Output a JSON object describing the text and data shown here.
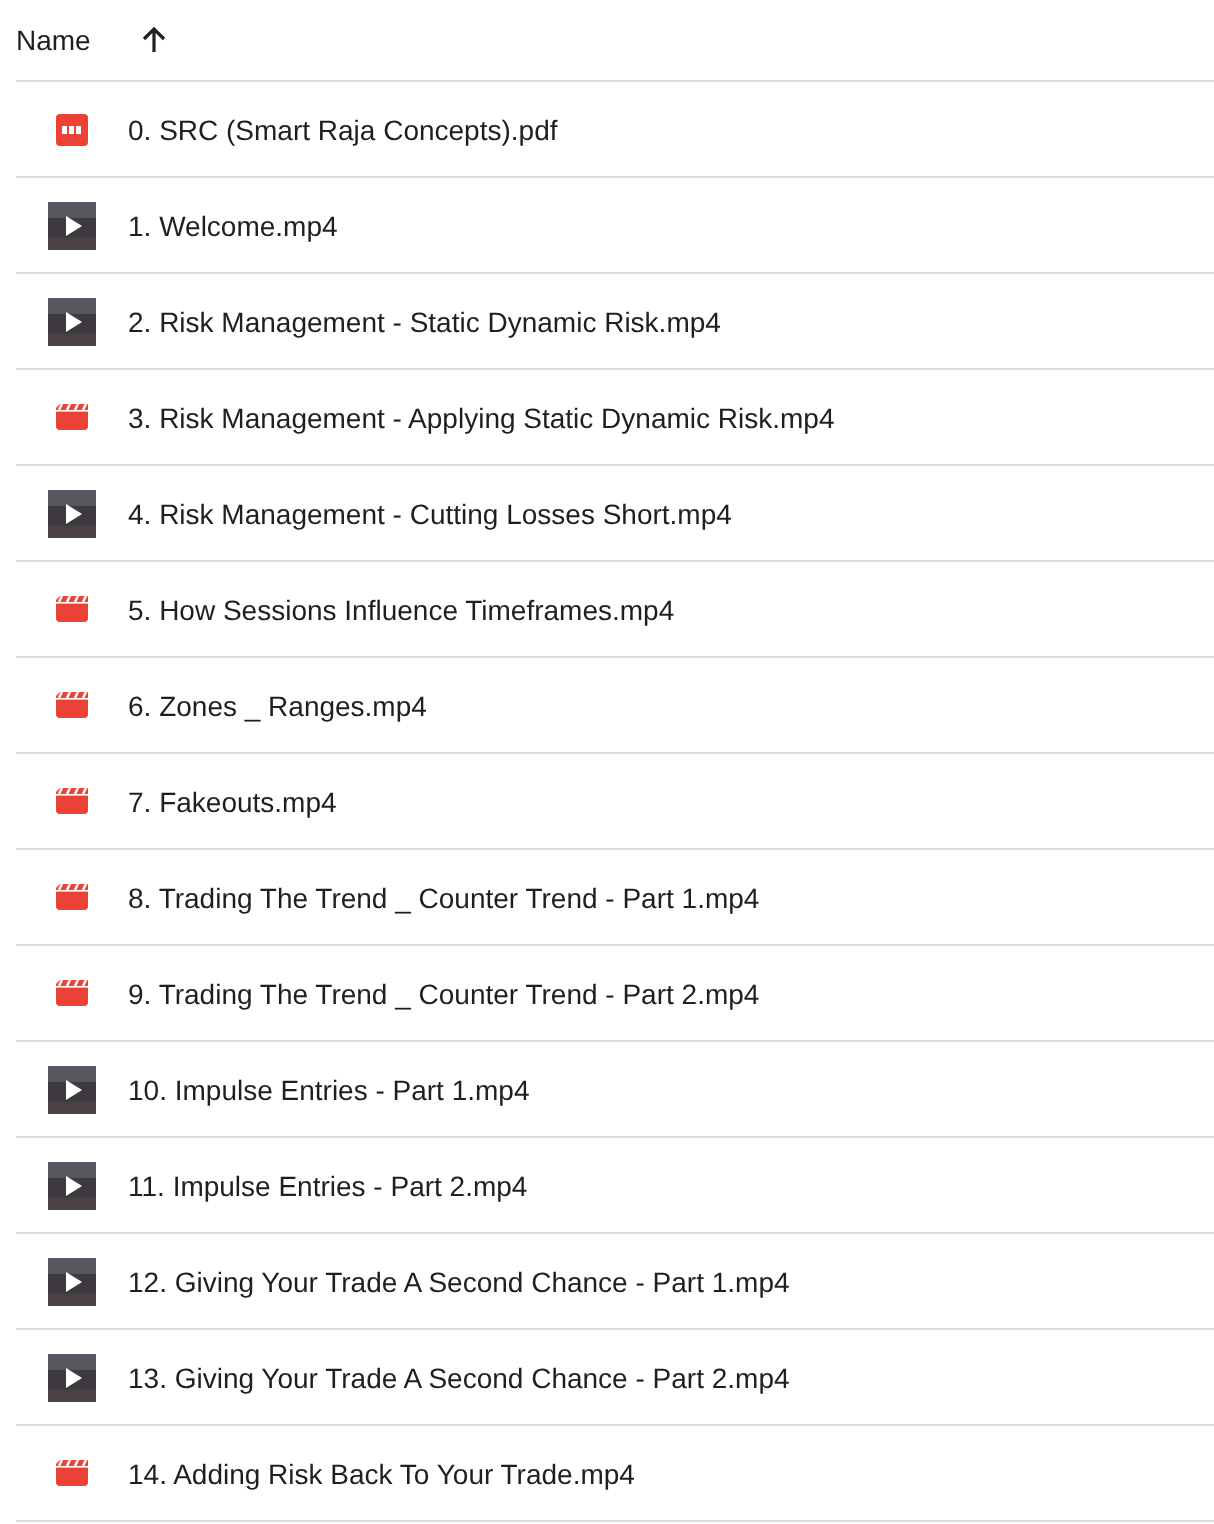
{
  "header": {
    "column": "Name",
    "sort_ascending": true
  },
  "files": [
    {
      "name": "0. SRC (Smart Raja Concepts).pdf",
      "kind": "pdf"
    },
    {
      "name": "1. Welcome.mp4",
      "kind": "thumbnail"
    },
    {
      "name": "2. Risk Management - Static Dynamic Risk.mp4",
      "kind": "thumbnail"
    },
    {
      "name": "3. Risk Management - Applying Static Dynamic Risk.mp4",
      "kind": "video"
    },
    {
      "name": "4. Risk Management - Cutting Losses Short.mp4",
      "kind": "thumbnail"
    },
    {
      "name": "5. How Sessions Influence Timeframes.mp4",
      "kind": "video"
    },
    {
      "name": "6. Zones _ Ranges.mp4",
      "kind": "video"
    },
    {
      "name": "7. Fakeouts.mp4",
      "kind": "video"
    },
    {
      "name": "8. Trading The Trend _ Counter Trend - Part 1.mp4",
      "kind": "video"
    },
    {
      "name": "9. Trading The Trend _ Counter Trend - Part 2.mp4",
      "kind": "video"
    },
    {
      "name": "10. Impulse Entries - Part 1.mp4",
      "kind": "thumbnail"
    },
    {
      "name": "11. Impulse Entries - Part 2.mp4",
      "kind": "thumbnail"
    },
    {
      "name": "12. Giving Your Trade A Second Chance - Part 1.mp4",
      "kind": "thumbnail"
    },
    {
      "name": "13. Giving Your Trade A Second Chance - Part 2.mp4",
      "kind": "thumbnail"
    },
    {
      "name": "14. Adding Risk Back To Your Trade.mp4",
      "kind": "video"
    }
  ]
}
